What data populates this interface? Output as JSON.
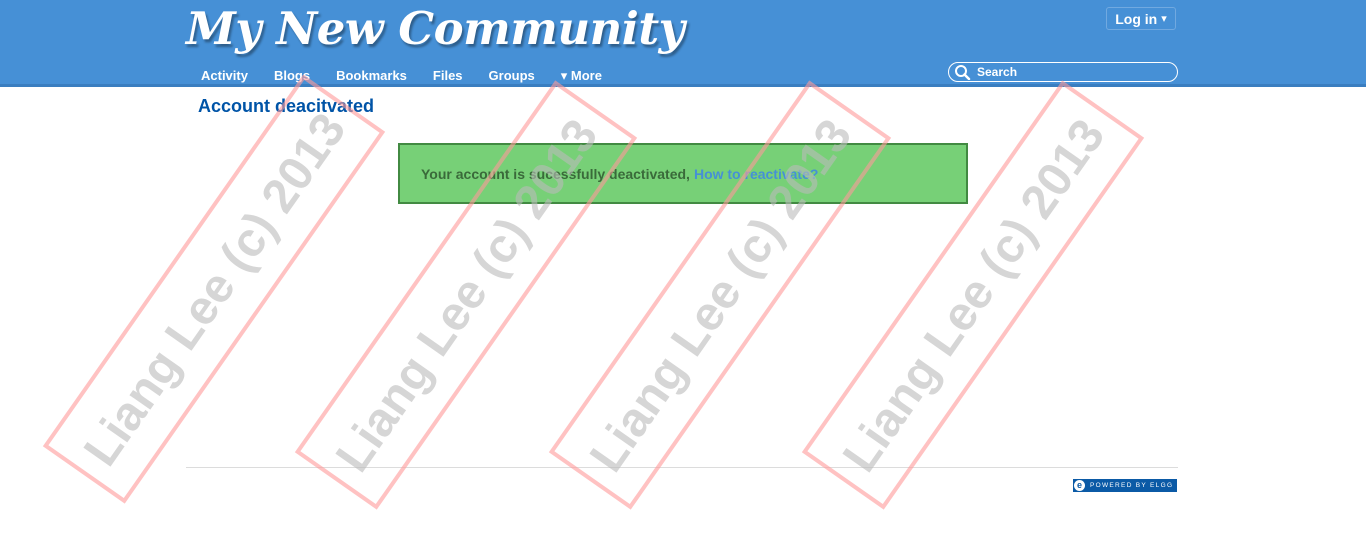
{
  "header": {
    "site_title": "My New Community",
    "login_label": "Log in",
    "login_caret": "▾",
    "search_placeholder": "Search"
  },
  "nav": {
    "items": [
      {
        "label": "Activity"
      },
      {
        "label": "Blogs"
      },
      {
        "label": "Bookmarks"
      },
      {
        "label": "Files"
      },
      {
        "label": "Groups"
      },
      {
        "label": "▾ More"
      }
    ]
  },
  "main": {
    "title": "Account deacitvated",
    "message_text": "Your account is sucessfully deactivated,",
    "message_link": "How to reactivate?"
  },
  "footer": {
    "badge_text": "POWERED BY ELGG",
    "badge_letter": "e"
  },
  "watermark": {
    "text": "Liang Lee (c) 2013"
  },
  "colors": {
    "header_bg": "#4690d6",
    "title_blue": "#0054a7",
    "success_bg": "#77d077",
    "success_border": "#428a42"
  }
}
